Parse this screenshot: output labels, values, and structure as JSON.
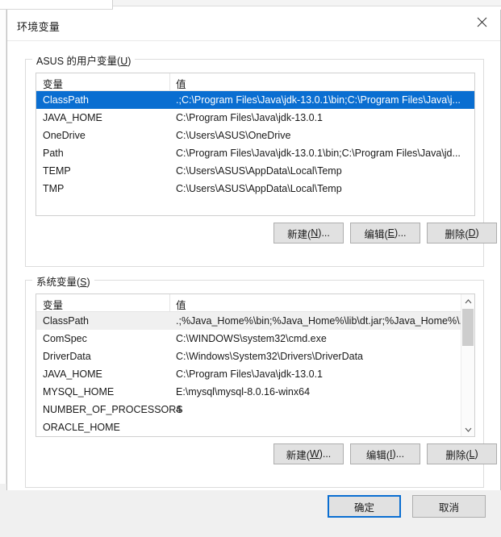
{
  "window": {
    "title": "环境变量",
    "close_icon": "close-icon"
  },
  "user_section": {
    "label_prefix": "ASUS 的用户变量(",
    "label_accel": "U",
    "label_suffix": ")",
    "columns": {
      "name": "变量",
      "value": "值"
    },
    "rows": [
      {
        "name": "ClassPath",
        "value": ".;C:\\Program Files\\Java\\jdk-13.0.1\\bin;C:\\Program Files\\Java\\j...",
        "selected": true
      },
      {
        "name": "JAVA_HOME",
        "value": "C:\\Program Files\\Java\\jdk-13.0.1",
        "selected": false
      },
      {
        "name": "OneDrive",
        "value": "C:\\Users\\ASUS\\OneDrive",
        "selected": false
      },
      {
        "name": "Path",
        "value": "C:\\Program Files\\Java\\jdk-13.0.1\\bin;C:\\Program Files\\Java\\jd...",
        "selected": false
      },
      {
        "name": "TEMP",
        "value": "C:\\Users\\ASUS\\AppData\\Local\\Temp",
        "selected": false
      },
      {
        "name": "TMP",
        "value": "C:\\Users\\ASUS\\AppData\\Local\\Temp",
        "selected": false
      }
    ],
    "buttons": {
      "new": {
        "prefix": "新建(",
        "accel": "N",
        "suffix": ")..."
      },
      "edit": {
        "prefix": "编辑(",
        "accel": "E",
        "suffix": ")..."
      },
      "delete": {
        "prefix": "删除(",
        "accel": "D",
        "suffix": ")"
      }
    }
  },
  "system_section": {
    "label_prefix": "系统变量(",
    "label_accel": "S",
    "label_suffix": ")",
    "columns": {
      "name": "变量",
      "value": "值"
    },
    "rows": [
      {
        "name": "ClassPath",
        "value": ".;%Java_Home%\\bin;%Java_Home%\\lib\\dt.jar;%Java_Home%\\...",
        "selected": true
      },
      {
        "name": "ComSpec",
        "value": "C:\\WINDOWS\\system32\\cmd.exe",
        "selected": false
      },
      {
        "name": "DriverData",
        "value": "C:\\Windows\\System32\\Drivers\\DriverData",
        "selected": false
      },
      {
        "name": "JAVA_HOME",
        "value": "C:\\Program Files\\Java\\jdk-13.0.1",
        "selected": false
      },
      {
        "name": "MYSQL_HOME",
        "value": "E:\\mysql\\mysql-8.0.16-winx64",
        "selected": false
      },
      {
        "name": "NUMBER_OF_PROCESSORS",
        "value": "4",
        "selected": false
      },
      {
        "name": "ORACLE_HOME",
        "value": "",
        "selected": false
      }
    ],
    "buttons": {
      "new": {
        "prefix": "新建(",
        "accel": "W",
        "suffix": ")..."
      },
      "edit": {
        "prefix": "编辑(",
        "accel": "I",
        "suffix": ")..."
      },
      "delete": {
        "prefix": "删除(",
        "accel": "L",
        "suffix": ")"
      }
    },
    "scrollbar": {
      "up_icon": "chevron-up-icon",
      "down_icon": "chevron-down-icon"
    }
  },
  "footer": {
    "ok_label": "确定",
    "cancel_label": "取消"
  },
  "colors": {
    "selection_focus": "#0a6ed1",
    "selection_blur": "#f0f0f0",
    "dialog_bg": "#ffffff",
    "button_bg": "#e1e1e1"
  }
}
